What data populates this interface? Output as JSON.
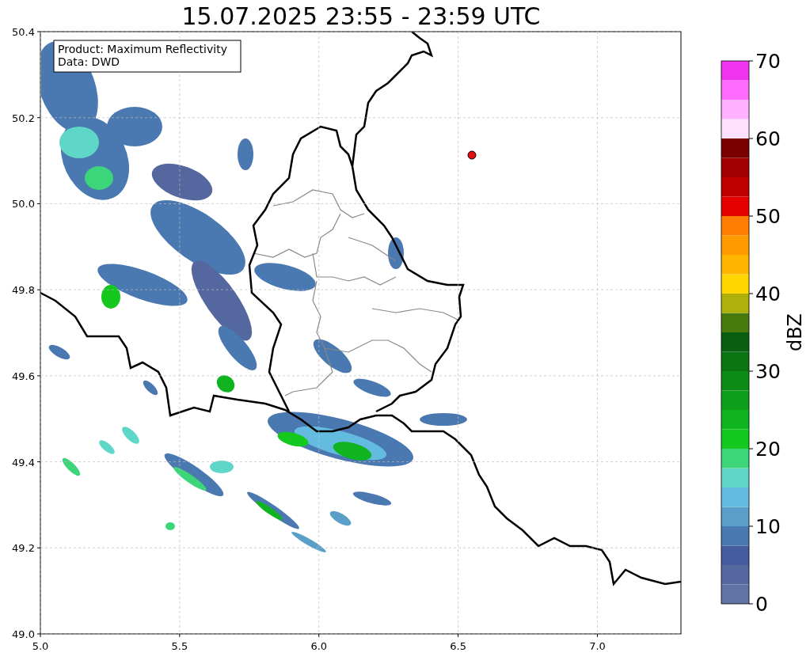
{
  "title": "15.07.2025 23:55 - 23:59 UTC",
  "info_box": {
    "lines": [
      "Product: Maximum Reflectivity",
      "Data: DWD"
    ]
  },
  "x_axis": {
    "ticks": [
      "5.0",
      "5.5",
      "6.0",
      "6.5",
      "7.0"
    ]
  },
  "y_axis": {
    "ticks": [
      "50.4",
      "50.2",
      "50.0",
      "49.8",
      "49.6",
      "49.4",
      "49.2",
      "49.0"
    ]
  },
  "colorbar": {
    "label": "dBZ",
    "ticks": [
      "70",
      "60",
      "50",
      "40",
      "30",
      "20",
      "10",
      "0"
    ],
    "bins": [
      {
        "color": "#6073a6"
      },
      {
        "color": "#55679f"
      },
      {
        "color": "#455d9f"
      },
      {
        "color": "#4a78b0"
      },
      {
        "color": "#5a9fc8"
      },
      {
        "color": "#63bce0"
      },
      {
        "color": "#5fd7c8"
      },
      {
        "color": "#3cd57a"
      },
      {
        "color": "#14c81e"
      },
      {
        "color": "#10b420"
      },
      {
        "color": "#0e9e19"
      },
      {
        "color": "#0b8a14"
      },
      {
        "color": "#0a7412"
      },
      {
        "color": "#0a5e10"
      },
      {
        "color": "#487a0e"
      },
      {
        "color": "#b0b00a"
      },
      {
        "color": "#ffd700"
      },
      {
        "color": "#ffb400"
      },
      {
        "color": "#ff9b00"
      },
      {
        "color": "#ff7d00"
      },
      {
        "color": "#e60000"
      },
      {
        "color": "#c00000"
      },
      {
        "color": "#a00000"
      },
      {
        "color": "#7a0000"
      },
      {
        "color": "#ffe0ff"
      },
      {
        "color": "#ffb0ff"
      },
      {
        "color": "#ff6aff"
      },
      {
        "color": "#f035f0"
      }
    ]
  }
}
